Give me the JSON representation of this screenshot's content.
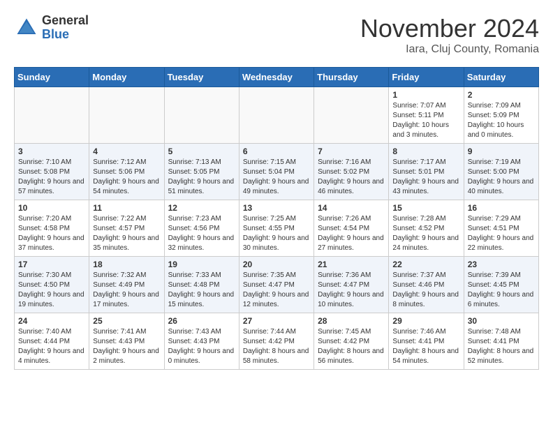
{
  "header": {
    "logo_general": "General",
    "logo_blue": "Blue",
    "month_title": "November 2024",
    "location": "Iara, Cluj County, Romania"
  },
  "days_of_week": [
    "Sunday",
    "Monday",
    "Tuesday",
    "Wednesday",
    "Thursday",
    "Friday",
    "Saturday"
  ],
  "weeks": [
    [
      {
        "day": "",
        "info": ""
      },
      {
        "day": "",
        "info": ""
      },
      {
        "day": "",
        "info": ""
      },
      {
        "day": "",
        "info": ""
      },
      {
        "day": "",
        "info": ""
      },
      {
        "day": "1",
        "info": "Sunrise: 7:07 AM\nSunset: 5:11 PM\nDaylight: 10 hours and 3 minutes."
      },
      {
        "day": "2",
        "info": "Sunrise: 7:09 AM\nSunset: 5:09 PM\nDaylight: 10 hours and 0 minutes."
      }
    ],
    [
      {
        "day": "3",
        "info": "Sunrise: 7:10 AM\nSunset: 5:08 PM\nDaylight: 9 hours and 57 minutes."
      },
      {
        "day": "4",
        "info": "Sunrise: 7:12 AM\nSunset: 5:06 PM\nDaylight: 9 hours and 54 minutes."
      },
      {
        "day": "5",
        "info": "Sunrise: 7:13 AM\nSunset: 5:05 PM\nDaylight: 9 hours and 51 minutes."
      },
      {
        "day": "6",
        "info": "Sunrise: 7:15 AM\nSunset: 5:04 PM\nDaylight: 9 hours and 49 minutes."
      },
      {
        "day": "7",
        "info": "Sunrise: 7:16 AM\nSunset: 5:02 PM\nDaylight: 9 hours and 46 minutes."
      },
      {
        "day": "8",
        "info": "Sunrise: 7:17 AM\nSunset: 5:01 PM\nDaylight: 9 hours and 43 minutes."
      },
      {
        "day": "9",
        "info": "Sunrise: 7:19 AM\nSunset: 5:00 PM\nDaylight: 9 hours and 40 minutes."
      }
    ],
    [
      {
        "day": "10",
        "info": "Sunrise: 7:20 AM\nSunset: 4:58 PM\nDaylight: 9 hours and 37 minutes."
      },
      {
        "day": "11",
        "info": "Sunrise: 7:22 AM\nSunset: 4:57 PM\nDaylight: 9 hours and 35 minutes."
      },
      {
        "day": "12",
        "info": "Sunrise: 7:23 AM\nSunset: 4:56 PM\nDaylight: 9 hours and 32 minutes."
      },
      {
        "day": "13",
        "info": "Sunrise: 7:25 AM\nSunset: 4:55 PM\nDaylight: 9 hours and 30 minutes."
      },
      {
        "day": "14",
        "info": "Sunrise: 7:26 AM\nSunset: 4:54 PM\nDaylight: 9 hours and 27 minutes."
      },
      {
        "day": "15",
        "info": "Sunrise: 7:28 AM\nSunset: 4:52 PM\nDaylight: 9 hours and 24 minutes."
      },
      {
        "day": "16",
        "info": "Sunrise: 7:29 AM\nSunset: 4:51 PM\nDaylight: 9 hours and 22 minutes."
      }
    ],
    [
      {
        "day": "17",
        "info": "Sunrise: 7:30 AM\nSunset: 4:50 PM\nDaylight: 9 hours and 19 minutes."
      },
      {
        "day": "18",
        "info": "Sunrise: 7:32 AM\nSunset: 4:49 PM\nDaylight: 9 hours and 17 minutes."
      },
      {
        "day": "19",
        "info": "Sunrise: 7:33 AM\nSunset: 4:48 PM\nDaylight: 9 hours and 15 minutes."
      },
      {
        "day": "20",
        "info": "Sunrise: 7:35 AM\nSunset: 4:47 PM\nDaylight: 9 hours and 12 minutes."
      },
      {
        "day": "21",
        "info": "Sunrise: 7:36 AM\nSunset: 4:47 PM\nDaylight: 9 hours and 10 minutes."
      },
      {
        "day": "22",
        "info": "Sunrise: 7:37 AM\nSunset: 4:46 PM\nDaylight: 9 hours and 8 minutes."
      },
      {
        "day": "23",
        "info": "Sunrise: 7:39 AM\nSunset: 4:45 PM\nDaylight: 9 hours and 6 minutes."
      }
    ],
    [
      {
        "day": "24",
        "info": "Sunrise: 7:40 AM\nSunset: 4:44 PM\nDaylight: 9 hours and 4 minutes."
      },
      {
        "day": "25",
        "info": "Sunrise: 7:41 AM\nSunset: 4:43 PM\nDaylight: 9 hours and 2 minutes."
      },
      {
        "day": "26",
        "info": "Sunrise: 7:43 AM\nSunset: 4:43 PM\nDaylight: 9 hours and 0 minutes."
      },
      {
        "day": "27",
        "info": "Sunrise: 7:44 AM\nSunset: 4:42 PM\nDaylight: 8 hours and 58 minutes."
      },
      {
        "day": "28",
        "info": "Sunrise: 7:45 AM\nSunset: 4:42 PM\nDaylight: 8 hours and 56 minutes."
      },
      {
        "day": "29",
        "info": "Sunrise: 7:46 AM\nSunset: 4:41 PM\nDaylight: 8 hours and 54 minutes."
      },
      {
        "day": "30",
        "info": "Sunrise: 7:48 AM\nSunset: 4:41 PM\nDaylight: 8 hours and 52 minutes."
      }
    ]
  ]
}
